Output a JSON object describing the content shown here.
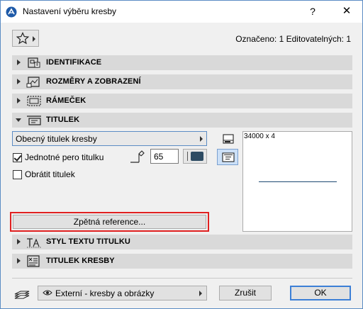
{
  "window": {
    "title": "Nastavení výběru kresby",
    "help_label": "?",
    "close_label": "✕"
  },
  "toolbar": {
    "favorites_icon": "star-icon",
    "selected_info": "Označeno: 1 Editovatelných: 1"
  },
  "sections": {
    "identification": "IDENTIFIKACE",
    "size_display": "ROZMĚRY A ZOBRAZENÍ",
    "frame": "RÁMEČEK",
    "title": "TITULEK",
    "title_text_style": "STYL TEXTU TITULKU",
    "drawing_title": "TITULEK KRESBY"
  },
  "title_panel": {
    "title_type": "Obecný titulek kresby",
    "uniform_pen_label": "Jednotné pero titulku",
    "uniform_pen_checked": true,
    "pen_value": "65",
    "pen_color": "#2d4b63",
    "flip_title_label": "Obrátit titulek",
    "flip_title_checked": false,
    "preview_text": "34000 x 4",
    "back_reference_label": "Zpětná reference..."
  },
  "footer": {
    "layer_value": "Externí - kresby a obrázky",
    "cancel_label": "Zrušit",
    "ok_label": "OK"
  },
  "colors": {
    "accent": "#3c7fd6",
    "highlight": "#e02020",
    "section_bg": "#d9d9d9"
  }
}
